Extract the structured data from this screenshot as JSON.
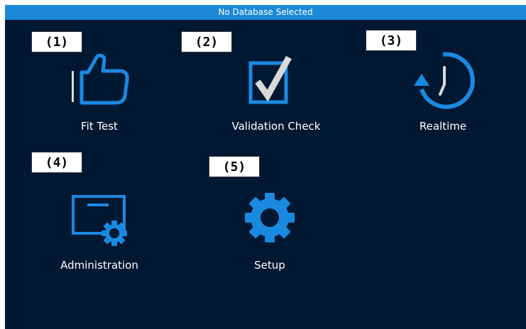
{
  "status_bar": {
    "text": "No Database Selected"
  },
  "colors": {
    "background": "#011833",
    "accent": "#1c88d8",
    "icon_blue": "#1a8ae0",
    "icon_light": "#d9d9d9"
  },
  "tiles": [
    {
      "label": "Fit Test",
      "icon": "thumbs-up-icon",
      "callout": "(1)"
    },
    {
      "label": "Validation Check",
      "icon": "checkbox-icon",
      "callout": "(2)"
    },
    {
      "label": "Realtime",
      "icon": "clock-refresh-icon",
      "callout": "(3)"
    },
    {
      "label": "Administration",
      "icon": "certificate-gear-icon",
      "callout": "(4)"
    },
    {
      "label": "Setup",
      "icon": "gear-icon",
      "callout": "(5)"
    }
  ]
}
